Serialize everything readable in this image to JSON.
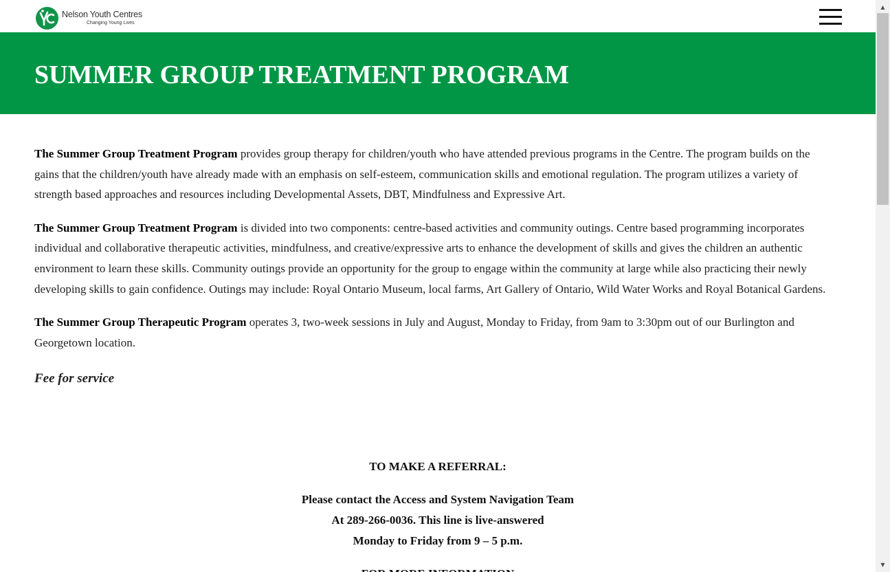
{
  "header": {
    "logo_name": "Nelson Youth Centres",
    "logo_tagline": "Changing Young Lives",
    "menu_icon": "hamburger-menu-icon"
  },
  "hero": {
    "title": "SUMMER GROUP TREATMENT PROGRAM",
    "background": "#009645"
  },
  "content": {
    "p1_bold": "The Summer Group Treatment Program",
    "p1_text": " provides group therapy for children/youth who have attended previous programs in the Centre. The program builds on the gains that the children/youth have already made with an emphasis on self-esteem, communication skills and emotional regulation. The program utilizes a variety of strength based approaches and resources including Developmental Assets, DBT, Mindfulness and Expressive Art.",
    "p2_bold": "The Summer Group Treatment Program",
    "p2_text": " is divided into two components: centre-based activities and community outings. Centre based programming incorporates individual and collaborative therapeutic activities, mindfulness, and creative/expressive arts to enhance the development of skills and gives the children an authentic environment to learn these skills. Community outings provide an opportunity for the group to engage within the community at large while also practicing their newly developing skills to gain confidence. Outings may include: Royal Ontario Museum, local farms, Art Gallery of Ontario, Wild Water Works and Royal Botanical Gardens.",
    "p3_bold": "The Summer Group Therapeutic Program",
    "p3_text": " operates 3, two-week sessions in July and August, Monday to Friday, from 9am to 3:30pm out of our Burlington and Georgetown location.",
    "fee": "Fee for service"
  },
  "referral": {
    "heading": "TO MAKE A REFERRAL:",
    "line1": "Please contact the Access and System Navigation Team",
    "line2": "At 289-266-0036. This line is live-answered",
    "line3": "Monday to Friday from 9 – 5 p.m.",
    "more_info": "FOR MORE INFORMATION"
  },
  "scrollbar": {
    "up_icon": "scroll-up-icon",
    "down_icon": "scroll-down-icon"
  }
}
